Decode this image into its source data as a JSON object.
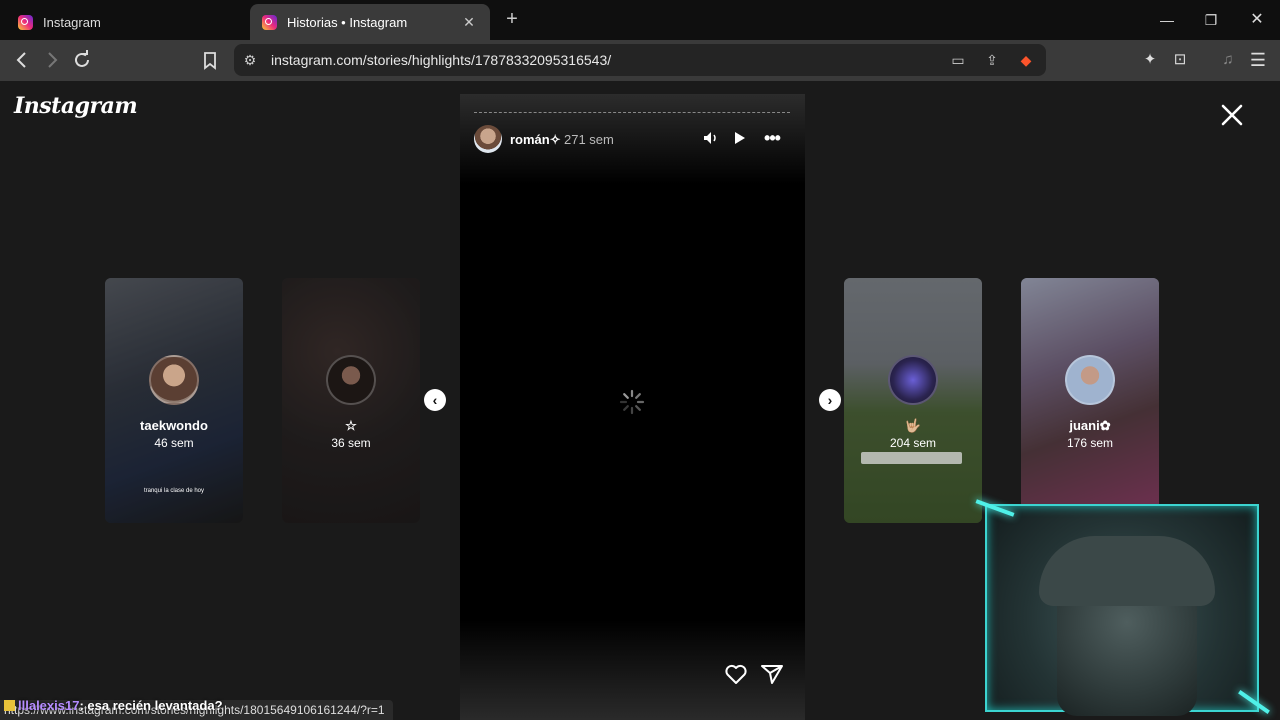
{
  "browser": {
    "tabs": [
      {
        "title": "Instagram",
        "active": false
      },
      {
        "title": "Historias • Instagram",
        "active": true
      }
    ],
    "url": "instagram.com/stories/highlights/17878332095316543/",
    "status_url": "https://www.instagram.com/stories/highlights/18015649106161244/?r=1"
  },
  "page": {
    "logo": "Instagram",
    "story": {
      "author": "román✧",
      "time": "271 sem"
    },
    "side_stories": [
      {
        "name": "taekwondo",
        "time": "46 sem",
        "caption": "tranqui la clase de hoy"
      },
      {
        "name": "☆",
        "time": "36 sem"
      },
      {
        "name": "🤟🏼",
        "time": "204 sem"
      },
      {
        "name": "juani✿",
        "time": "176 sem"
      }
    ]
  },
  "overlay": {
    "chat_user": "lllalexis17",
    "chat_message": ": esa recién levantada?"
  },
  "colors": {
    "background": "#1a1a1a",
    "tabbar": "#0f0f0f",
    "toolbar": "#3a3a3a",
    "webcam_frame": "#3cd4d0"
  }
}
